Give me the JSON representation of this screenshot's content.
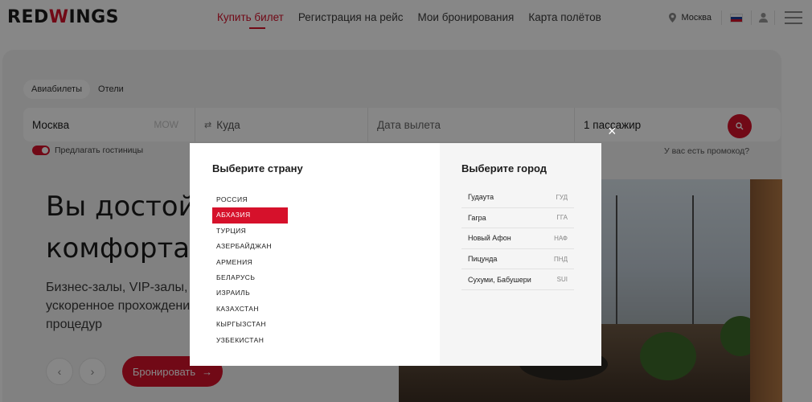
{
  "header": {
    "logo_prefix": "RED",
    "logo_mark": "W",
    "logo_suffix": "INGS",
    "nav": [
      "Купить билет",
      "Регистрация на рейс",
      "Мои бронирования",
      "Карта полётов"
    ],
    "active_nav": "Купить билет",
    "city": "Москва",
    "icons": {
      "pin": "map-pin-icon",
      "flag": "russia-flag-icon",
      "user": "user-icon",
      "menu": "hamburger-menu-icon"
    }
  },
  "search": {
    "tabs": [
      "Авиабилеты",
      "Отели"
    ],
    "selected_tab": "Авиабилеты",
    "from_value": "Москва",
    "from_code": "MOW",
    "to_placeholder": "Куда",
    "date_placeholder": "Дата вылета",
    "passengers": "1 пассажир",
    "hotels_toggle_label": "Предлагать гостиницы",
    "hotels_toggle_on": true,
    "promo_link": "У вас есть промокод?"
  },
  "hero": {
    "title_line1": "Вы достойны",
    "title_line2": "комфорта",
    "sub_line1": "Бизнес-залы, VIP-залы,",
    "sub_line2": "ускоренное прохождение",
    "sub_line3": "процедур",
    "prev_label": "‹",
    "next_label": "›",
    "book_label": "Бронировать",
    "book_arrow": "→"
  },
  "modal": {
    "country_title": "Выберите страну",
    "city_title": "Выберите город",
    "close_label": "×",
    "countries": [
      "РОССИЯ",
      "АБХАЗИЯ",
      "ТУРЦИЯ",
      "АЗЕРБАЙДЖАН",
      "АРМЕНИЯ",
      "БЕЛАРУСЬ",
      "ИЗРАИЛЬ",
      "КАЗАХСТАН",
      "КЫРГЫЗСТАН",
      "УЗБЕКИСТАН"
    ],
    "selected_country": "АБХАЗИЯ",
    "cities": [
      {
        "name": "Гудаута",
        "code": "ГУД"
      },
      {
        "name": "Гагра",
        "code": "ГГА"
      },
      {
        "name": "Новый Афон",
        "code": "НАФ"
      },
      {
        "name": "Пицунда",
        "code": "ПНД"
      },
      {
        "name": "Сухуми, Бабушери",
        "code": "SUI"
      }
    ]
  },
  "colors": {
    "accent": "#d6112b",
    "overlay": "rgba(0,0,0,0.47)",
    "card": "#f3f3f3"
  }
}
